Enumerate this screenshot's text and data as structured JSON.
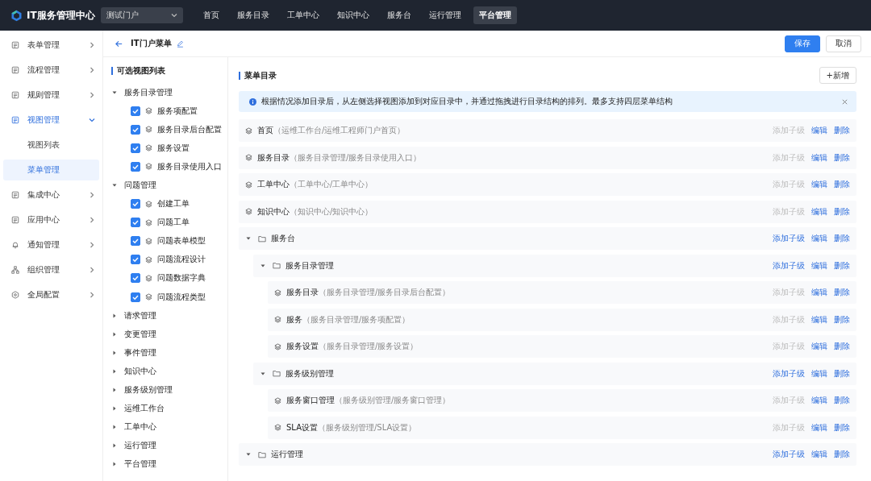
{
  "topbar": {
    "title": "IT服务管理中心",
    "portal_select": {
      "value": "测试门户"
    },
    "nav": [
      {
        "label": "首页",
        "selected": false
      },
      {
        "label": "服务目录",
        "selected": false
      },
      {
        "label": "工单中心",
        "selected": false
      },
      {
        "label": "知识中心",
        "selected": false
      },
      {
        "label": "服务台",
        "selected": false
      },
      {
        "label": "运行管理",
        "selected": false
      },
      {
        "label": "平台管理",
        "selected": true
      }
    ]
  },
  "sidebar": {
    "items": [
      {
        "label": "表单管理",
        "expanded": false,
        "selected": false
      },
      {
        "label": "流程管理",
        "expanded": false,
        "selected": false
      },
      {
        "label": "规则管理",
        "expanded": false,
        "selected": false
      },
      {
        "label": "视图管理",
        "expanded": true,
        "selected": true,
        "children": [
          {
            "label": "视图列表",
            "selected": false
          },
          {
            "label": "菜单管理",
            "selected": true
          }
        ]
      },
      {
        "label": "集成中心",
        "expanded": false,
        "selected": false
      },
      {
        "label": "应用中心",
        "expanded": false,
        "selected": false
      },
      {
        "label": "通知管理",
        "expanded": false,
        "selected": false
      },
      {
        "label": "组织管理",
        "expanded": false,
        "selected": false
      },
      {
        "label": "全局配置",
        "expanded": false,
        "selected": false
      }
    ]
  },
  "header": {
    "title": "IT门户菜单",
    "buttons": [
      {
        "label": "保存",
        "kind": "primary"
      },
      {
        "label": "取消",
        "kind": "default"
      }
    ]
  },
  "view_list": {
    "title": "可选视图列表",
    "groups": [
      {
        "label": "服务目录管理",
        "expanded": true,
        "children": [
          {
            "label": "服务项配置",
            "checked": true
          },
          {
            "label": "服务目录后台配置",
            "checked": true
          },
          {
            "label": "服务设置",
            "checked": true
          },
          {
            "label": "服务目录使用入口",
            "checked": true
          }
        ]
      },
      {
        "label": "问题管理",
        "expanded": true,
        "children": [
          {
            "label": "创建工单",
            "checked": true
          },
          {
            "label": "问题工单",
            "checked": true
          },
          {
            "label": "问题表单模型",
            "checked": true
          },
          {
            "label": "问题流程设计",
            "checked": true
          },
          {
            "label": "问题数据字典",
            "checked": true
          },
          {
            "label": "问题流程类型",
            "checked": true
          }
        ]
      },
      {
        "label": "请求管理",
        "expanded": false
      },
      {
        "label": "变更管理",
        "expanded": false
      },
      {
        "label": "事件管理",
        "expanded": false
      },
      {
        "label": "知识中心",
        "expanded": false
      },
      {
        "label": "服务级别管理",
        "expanded": false
      },
      {
        "label": "运维工作台",
        "expanded": false
      },
      {
        "label": "工单中心",
        "expanded": false
      },
      {
        "label": "运行管理",
        "expanded": false
      },
      {
        "label": "平台管理",
        "expanded": false
      }
    ]
  },
  "menu": {
    "title": "菜单目录",
    "add_button": "+新增",
    "alert": "根据情况添加目录后，从左侧选择视图添加到对应目录中，并通过拖拽进行目录结构的排列。最多支持四层菜单结构",
    "items": [
      {
        "kind": "view",
        "name": "首页",
        "path": "（运维工作台/运维工程师门户首页）",
        "actions": [
          {
            "label": "添加子级",
            "disabled": true
          },
          {
            "label": "编辑",
            "disabled": false
          },
          {
            "label": "删除",
            "disabled": false
          }
        ]
      },
      {
        "kind": "view",
        "name": "服务目录",
        "path": "（服务目录管理/服务目录使用入口）",
        "actions": [
          {
            "label": "添加子级",
            "disabled": true
          },
          {
            "label": "编辑",
            "disabled": false
          },
          {
            "label": "删除",
            "disabled": false
          }
        ]
      },
      {
        "kind": "view",
        "name": "工单中心",
        "path": "（工单中心/工单中心）",
        "actions": [
          {
            "label": "添加子级",
            "disabled": true
          },
          {
            "label": "编辑",
            "disabled": false
          },
          {
            "label": "删除",
            "disabled": false
          }
        ]
      },
      {
        "kind": "view",
        "name": "知识中心",
        "path": "（知识中心/知识中心）",
        "actions": [
          {
            "label": "添加子级",
            "disabled": true
          },
          {
            "label": "编辑",
            "disabled": false
          },
          {
            "label": "删除",
            "disabled": false
          }
        ]
      },
      {
        "kind": "folder",
        "name": "服务台",
        "expanded": true,
        "actions": [
          {
            "label": "添加子级",
            "disabled": false
          },
          {
            "label": "编辑",
            "disabled": false
          },
          {
            "label": "删除",
            "disabled": false
          }
        ],
        "children": [
          {
            "kind": "folder",
            "name": "服务目录管理",
            "expanded": true,
            "actions": [
              {
                "label": "添加子级",
                "disabled": false
              },
              {
                "label": "编辑",
                "disabled": false
              },
              {
                "label": "删除",
                "disabled": false
              }
            ],
            "children": [
              {
                "kind": "view",
                "name": "服务目录",
                "path": "（服务目录管理/服务目录后台配置）",
                "actions": [
                  {
                    "label": "添加子级",
                    "disabled": true
                  },
                  {
                    "label": "编辑",
                    "disabled": false
                  },
                  {
                    "label": "删除",
                    "disabled": false
                  }
                ]
              },
              {
                "kind": "view",
                "name": "服务",
                "path": "（服务目录管理/服务项配置）",
                "actions": [
                  {
                    "label": "添加子级",
                    "disabled": true
                  },
                  {
                    "label": "编辑",
                    "disabled": false
                  },
                  {
                    "label": "删除",
                    "disabled": false
                  }
                ]
              },
              {
                "kind": "view",
                "name": "服务设置",
                "path": "（服务目录管理/服务设置）",
                "actions": [
                  {
                    "label": "添加子级",
                    "disabled": true
                  },
                  {
                    "label": "编辑",
                    "disabled": false
                  },
                  {
                    "label": "删除",
                    "disabled": false
                  }
                ]
              }
            ]
          },
          {
            "kind": "folder",
            "name": "服务级别管理",
            "expanded": true,
            "actions": [
              {
                "label": "添加子级",
                "disabled": false
              },
              {
                "label": "编辑",
                "disabled": false
              },
              {
                "label": "删除",
                "disabled": false
              }
            ],
            "children": [
              {
                "kind": "view",
                "name": "服务窗口管理",
                "path": "（服务级别管理/服务窗口管理）",
                "actions": [
                  {
                    "label": "添加子级",
                    "disabled": true
                  },
                  {
                    "label": "编辑",
                    "disabled": false
                  },
                  {
                    "label": "删除",
                    "disabled": false
                  }
                ]
              },
              {
                "kind": "view",
                "name": "SLA设置",
                "path": "（服务级别管理/SLA设置）",
                "actions": [
                  {
                    "label": "添加子级",
                    "disabled": true
                  },
                  {
                    "label": "编辑",
                    "disabled": false
                  },
                  {
                    "label": "删除",
                    "disabled": false
                  }
                ]
              }
            ]
          }
        ]
      },
      {
        "kind": "folder",
        "name": "运行管理",
        "expanded": true,
        "actions": [
          {
            "label": "添加子级",
            "disabled": false
          },
          {
            "label": "编辑",
            "disabled": false
          },
          {
            "label": "删除",
            "disabled": false
          }
        ]
      }
    ]
  }
}
